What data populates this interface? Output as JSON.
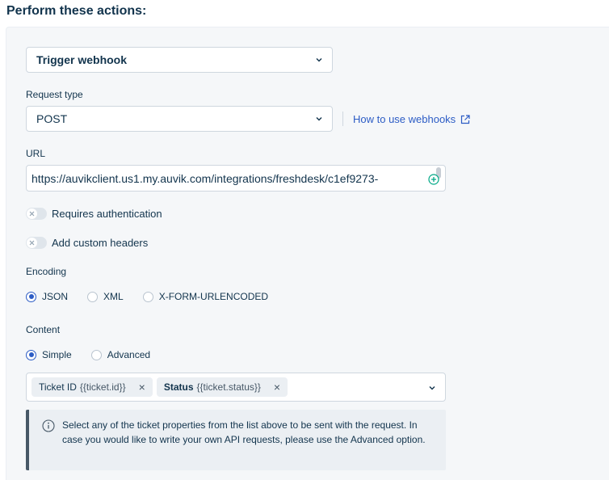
{
  "heading": "Perform these actions:",
  "action_select": {
    "value": "Trigger webhook"
  },
  "request_type": {
    "label": "Request type",
    "value": "POST"
  },
  "help_link": {
    "label": "How to use webhooks"
  },
  "url": {
    "label": "URL",
    "value": "https://auvikclient.us1.my.auvik.com/integrations/freshdesk/c1ef9273-"
  },
  "toggles": {
    "auth": {
      "label": "Requires authentication",
      "on": false
    },
    "headers": {
      "label": "Add custom headers",
      "on": false
    }
  },
  "encoding": {
    "label": "Encoding",
    "options": [
      "JSON",
      "XML",
      "X-FORM-URLENCODED"
    ],
    "selected": "JSON"
  },
  "content": {
    "label": "Content",
    "options": [
      "Simple",
      "Advanced"
    ],
    "selected": "Simple",
    "chips": [
      {
        "name": "Ticket ID",
        "token": "{{ticket.id}}"
      },
      {
        "name": "Status",
        "token": "{{ticket.status}}"
      }
    ]
  },
  "info_text": "Select any of the ticket properties from the list above to be sent with the request. In case you would like to write your own API requests, please use the Advanced option.",
  "colors": {
    "accent": "#2c5cc5",
    "text": "#12344d",
    "panel": "#f5f7f9",
    "border": "#cfd7df"
  }
}
